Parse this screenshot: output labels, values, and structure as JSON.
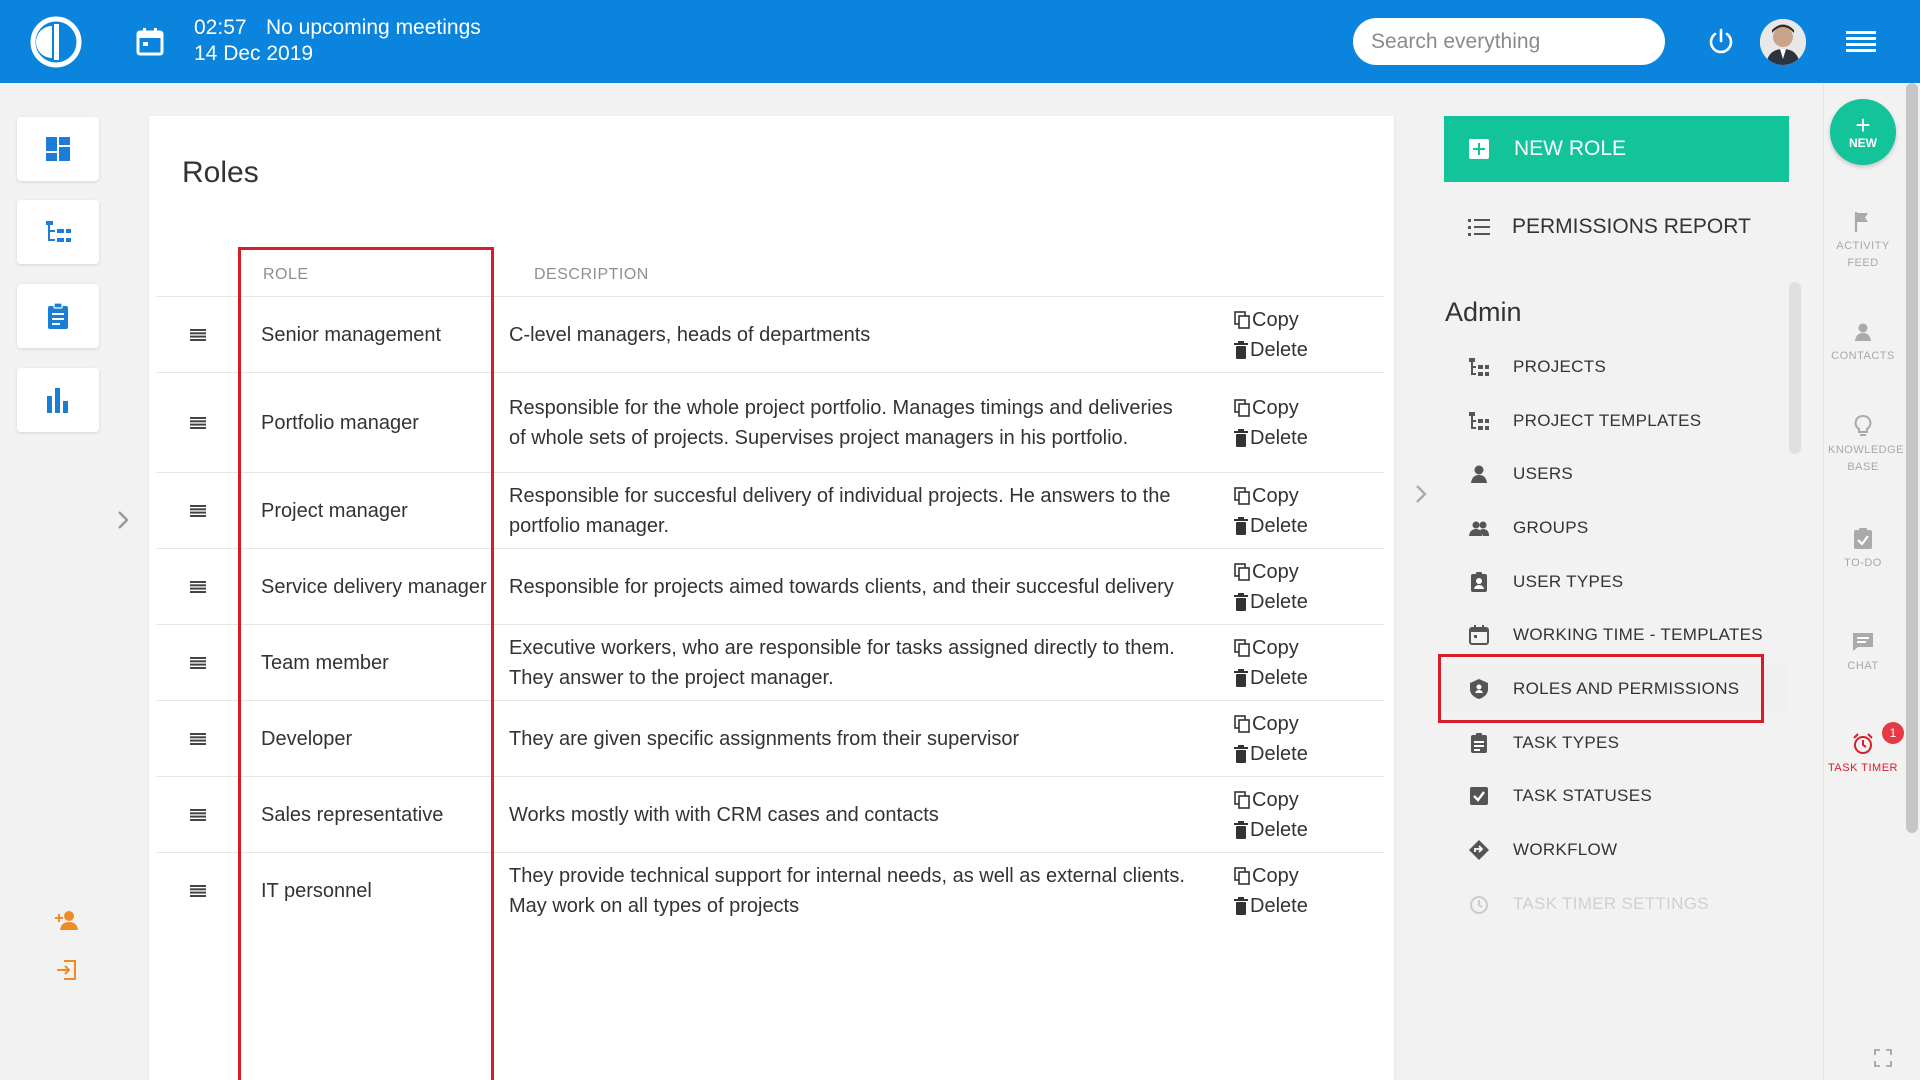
{
  "header": {
    "time": "02:57",
    "meeting_text": "No upcoming meetings",
    "date": "14 Dec 2019",
    "search_placeholder": "Search everything"
  },
  "left_sidebar": {
    "items": [
      "dashboard-icon",
      "projects-tree-icon",
      "clipboard-icon",
      "bar-chart-icon"
    ],
    "bottom": [
      "add-user-icon",
      "login-icon"
    ]
  },
  "page": {
    "title": "Roles",
    "columns": {
      "role": "ROLE",
      "description": "DESCRIPTION"
    },
    "copy_label": "Copy",
    "delete_label": "Delete",
    "rows": [
      {
        "role": "Senior management",
        "description": "C-level managers, heads of departments"
      },
      {
        "role": "Portfolio manager",
        "description": "Responsible for the whole project portfolio. Manages timings and deliveries of whole sets of projects. Supervises project managers in his portfolio."
      },
      {
        "role": "Project manager",
        "description": "Responsible for succesful delivery of individual projects. He answers to the portfolio manager."
      },
      {
        "role": "Service delivery manager",
        "description": "Responsible for projects aimed towards clients, and their succesful delivery"
      },
      {
        "role": "Team member",
        "description": "Executive workers, who are responsible for tasks assigned directly to them. They answer to the project manager."
      },
      {
        "role": "Developer",
        "description": "They are given specific assignments from their supervisor"
      },
      {
        "role": "Sales representative",
        "description": "Works mostly with with CRM cases and contacts"
      },
      {
        "role": "IT personnel",
        "description": "They provide technical support for internal needs, as well as external clients. May work on all types of projects"
      }
    ]
  },
  "actions": {
    "new_role": "NEW ROLE",
    "permissions_report": "PERMISSIONS REPORT"
  },
  "admin": {
    "title": "Admin",
    "items": [
      {
        "label": "PROJECTS",
        "icon": "projects-tree-icon"
      },
      {
        "label": "PROJECT TEMPLATES",
        "icon": "projects-tree-icon"
      },
      {
        "label": "USERS",
        "icon": "user-icon"
      },
      {
        "label": "GROUPS",
        "icon": "group-icon"
      },
      {
        "label": "USER TYPES",
        "icon": "badge-icon"
      },
      {
        "label": "WORKING TIME - TEMPLATES",
        "icon": "calendar-icon"
      },
      {
        "label": "ROLES AND PERMISSIONS",
        "icon": "shield-icon"
      },
      {
        "label": "TASK TYPES",
        "icon": "clipboard-icon"
      },
      {
        "label": "TASK STATUSES",
        "icon": "checkbox-icon"
      },
      {
        "label": "WORKFLOW",
        "icon": "diamond-arrow-icon"
      },
      {
        "label": "TASK TIMER SETTINGS",
        "icon": "alarm-icon"
      }
    ]
  },
  "right_rail": {
    "new_label": "NEW",
    "items": [
      {
        "label": "ACTIVITY FEED",
        "icon": "flag-icon"
      },
      {
        "label": "CONTACTS",
        "icon": "person-icon"
      },
      {
        "label": "KNOWLEDGE BASE",
        "icon": "lightbulb-icon"
      },
      {
        "label": "TO-DO",
        "icon": "checklist-icon"
      },
      {
        "label": "CHAT",
        "icon": "chat-icon"
      },
      {
        "label": "TASK TIMER",
        "icon": "alarm-icon"
      }
    ],
    "timer_badge": "1"
  },
  "colors": {
    "header": "#0a84dc",
    "accent_green": "#13c39a",
    "highlight_red": "#d41f2a"
  }
}
